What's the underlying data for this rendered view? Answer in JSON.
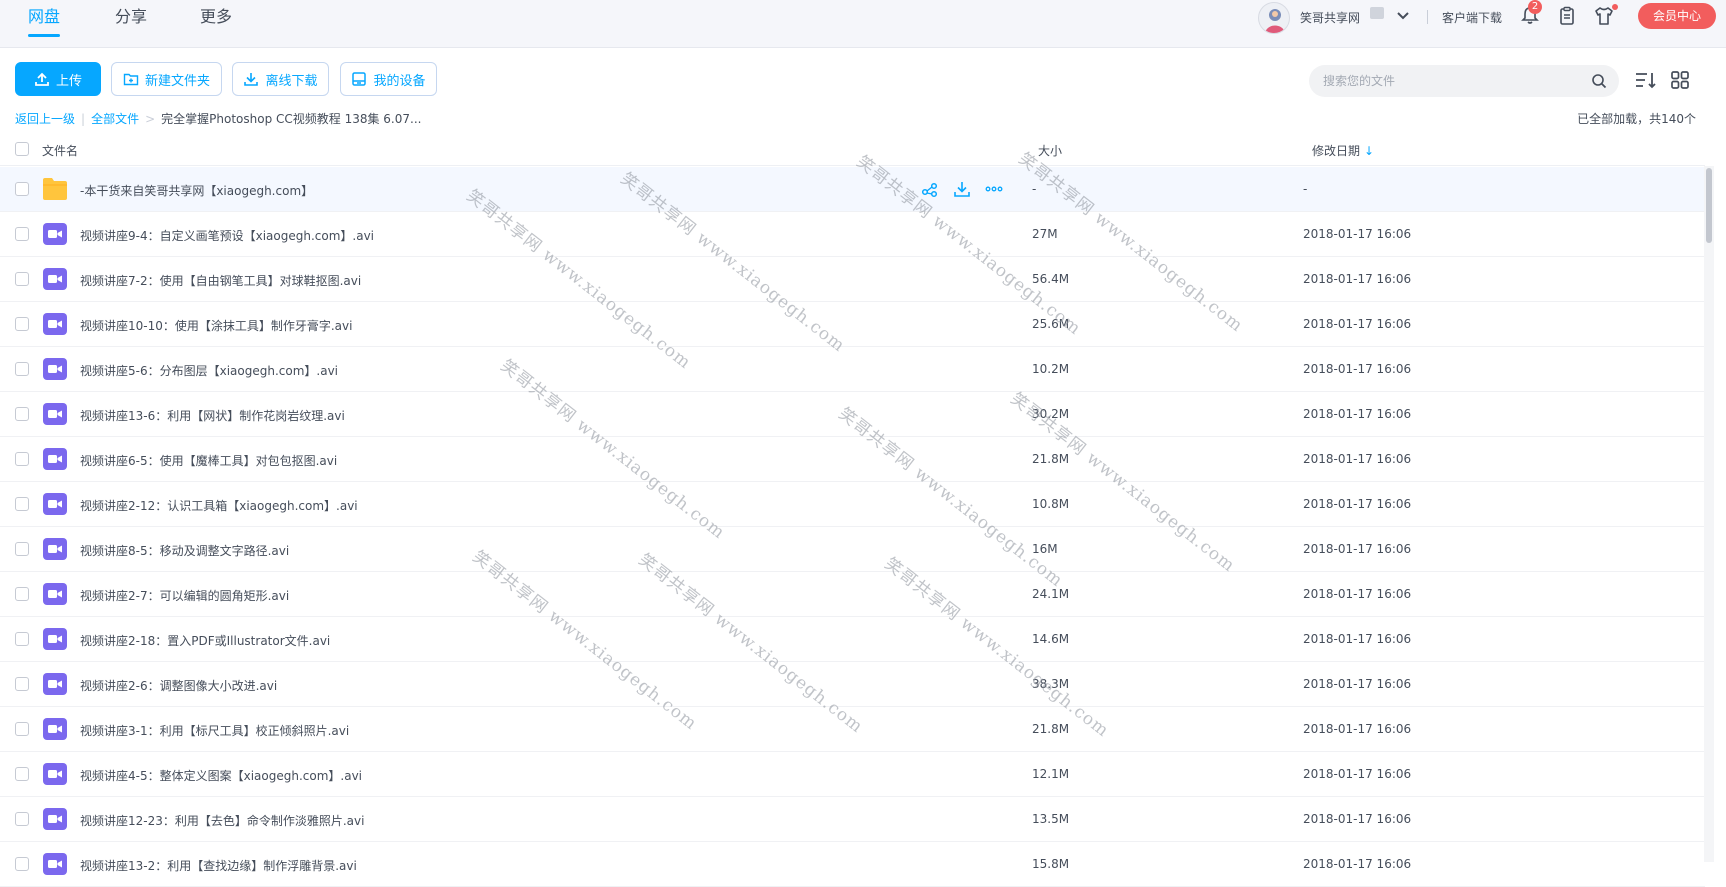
{
  "topnav": {
    "tabs": [
      {
        "label": "网盘",
        "active": true
      },
      {
        "label": "分享",
        "active": false
      },
      {
        "label": "更多",
        "active": false
      }
    ],
    "username": "笑哥共享网",
    "client_download": "客户端下载",
    "notification_count": "2",
    "vip_center": "会员中心"
  },
  "toolbar": {
    "upload": "上传",
    "new_folder": "新建文件夹",
    "offline_download": "离线下载",
    "my_devices": "我的设备",
    "search_placeholder": "搜索您的文件"
  },
  "breadcrumb": {
    "back": "返回上一级",
    "all_files": "全部文件",
    "current": "完全掌握Photoshop CC视频教程 138集 6.07..."
  },
  "loaded_status": "已全部加载，共140个",
  "table": {
    "headers": {
      "name": "文件名",
      "size": "大小",
      "date": "修改日期"
    },
    "rows": [
      {
        "name": "-本干货来自笑哥共享网【xiaogegh.com】",
        "size": "-",
        "date": "-",
        "type": "folder"
      },
      {
        "name": "视频讲座9-4：自定义画笔预设【xiaogegh.com】.avi",
        "size": "27M",
        "date": "2018-01-17 16:06",
        "type": "video"
      },
      {
        "name": "视频讲座7-2：使用【自由钢笔工具】对球鞋抠图.avi",
        "size": "56.4M",
        "date": "2018-01-17 16:06",
        "type": "video"
      },
      {
        "name": "视频讲座10-10：使用【涂抹工具】制作牙膏字.avi",
        "size": "25.6M",
        "date": "2018-01-17 16:06",
        "type": "video"
      },
      {
        "name": "视频讲座5-6：分布图层【xiaogegh.com】.avi",
        "size": "10.2M",
        "date": "2018-01-17 16:06",
        "type": "video"
      },
      {
        "name": "视频讲座13-6：利用【网状】制作花岗岩纹理.avi",
        "size": "30.2M",
        "date": "2018-01-17 16:06",
        "type": "video"
      },
      {
        "name": "视频讲座6-5：使用【魔棒工具】对包包抠图.avi",
        "size": "21.8M",
        "date": "2018-01-17 16:06",
        "type": "video"
      },
      {
        "name": "视频讲座2-12：认识工具箱【xiaogegh.com】.avi",
        "size": "10.8M",
        "date": "2018-01-17 16:06",
        "type": "video"
      },
      {
        "name": "视频讲座8-5：移动及调整文字路径.avi",
        "size": "16M",
        "date": "2018-01-17 16:06",
        "type": "video"
      },
      {
        "name": "视频讲座2-7：可以编辑的圆角矩形.avi",
        "size": "24.1M",
        "date": "2018-01-17 16:06",
        "type": "video"
      },
      {
        "name": "视频讲座2-18：置入PDF或Illustrator文件.avi",
        "size": "14.6M",
        "date": "2018-01-17 16:06",
        "type": "video"
      },
      {
        "name": "视频讲座2-6：调整图像大小改进.avi",
        "size": "38.3M",
        "date": "2018-01-17 16:06",
        "type": "video"
      },
      {
        "name": "视频讲座3-1：利用【标尺工具】校正倾斜照片.avi",
        "size": "21.8M",
        "date": "2018-01-17 16:06",
        "type": "video"
      },
      {
        "name": "视频讲座4-5：整体定义图案【xiaogegh.com】.avi",
        "size": "12.1M",
        "date": "2018-01-17 16:06",
        "type": "video"
      },
      {
        "name": "视频讲座12-23：利用【去色】命令制作淡雅照片.avi",
        "size": "13.5M",
        "date": "2018-01-17 16:06",
        "type": "video"
      },
      {
        "name": "视频讲座13-2：利用【查找边缘】制作浮雕背景.avi",
        "size": "15.8M",
        "date": "2018-01-17 16:06",
        "type": "video"
      }
    ]
  },
  "watermark": "笑哥共享网 www.xiaogegh.com",
  "colors": {
    "accent": "#06a7ff",
    "vip": "#f25d5d",
    "folder": "#ffc53d",
    "video": "#7b68ee"
  }
}
